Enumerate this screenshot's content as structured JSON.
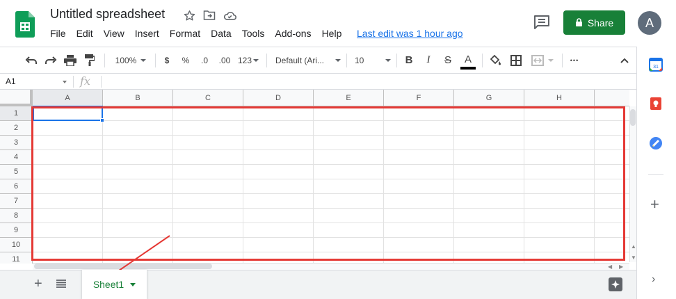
{
  "app": {
    "document_title": "Untitled spreadsheet",
    "last_edit": "Last edit was 1 hour ago",
    "share_label": "Share",
    "avatar_initial": "A",
    "brand_green": "#188038"
  },
  "menu": [
    "File",
    "Edit",
    "View",
    "Insert",
    "Format",
    "Data",
    "Tools",
    "Add-ons",
    "Help"
  ],
  "toolbar": {
    "zoom": "100%",
    "currency": "$",
    "percent": "%",
    "decrease_decimals": ".0",
    "increase_decimals": ".00",
    "more_formats": "123",
    "font_family": "Default (Ari...",
    "font_size": "10",
    "bold": "B",
    "italic": "I",
    "strikethrough": "S",
    "text_color": "A",
    "more": "•••"
  },
  "formula_bar": {
    "name_box": "A1",
    "fx_label": "fx"
  },
  "grid": {
    "columns": [
      "A",
      "B",
      "C",
      "D",
      "E",
      "F",
      "G",
      "H"
    ],
    "rows": [
      "1",
      "2",
      "3",
      "4",
      "5",
      "6",
      "7",
      "8",
      "9",
      "10",
      "11"
    ]
  },
  "sheet": {
    "tab_name": "Sheet1",
    "add_label": "+"
  },
  "side_panel": {
    "calendar_day": "31",
    "add_label": "+",
    "collapse_label": "›"
  },
  "annotation_color": "#e53935"
}
